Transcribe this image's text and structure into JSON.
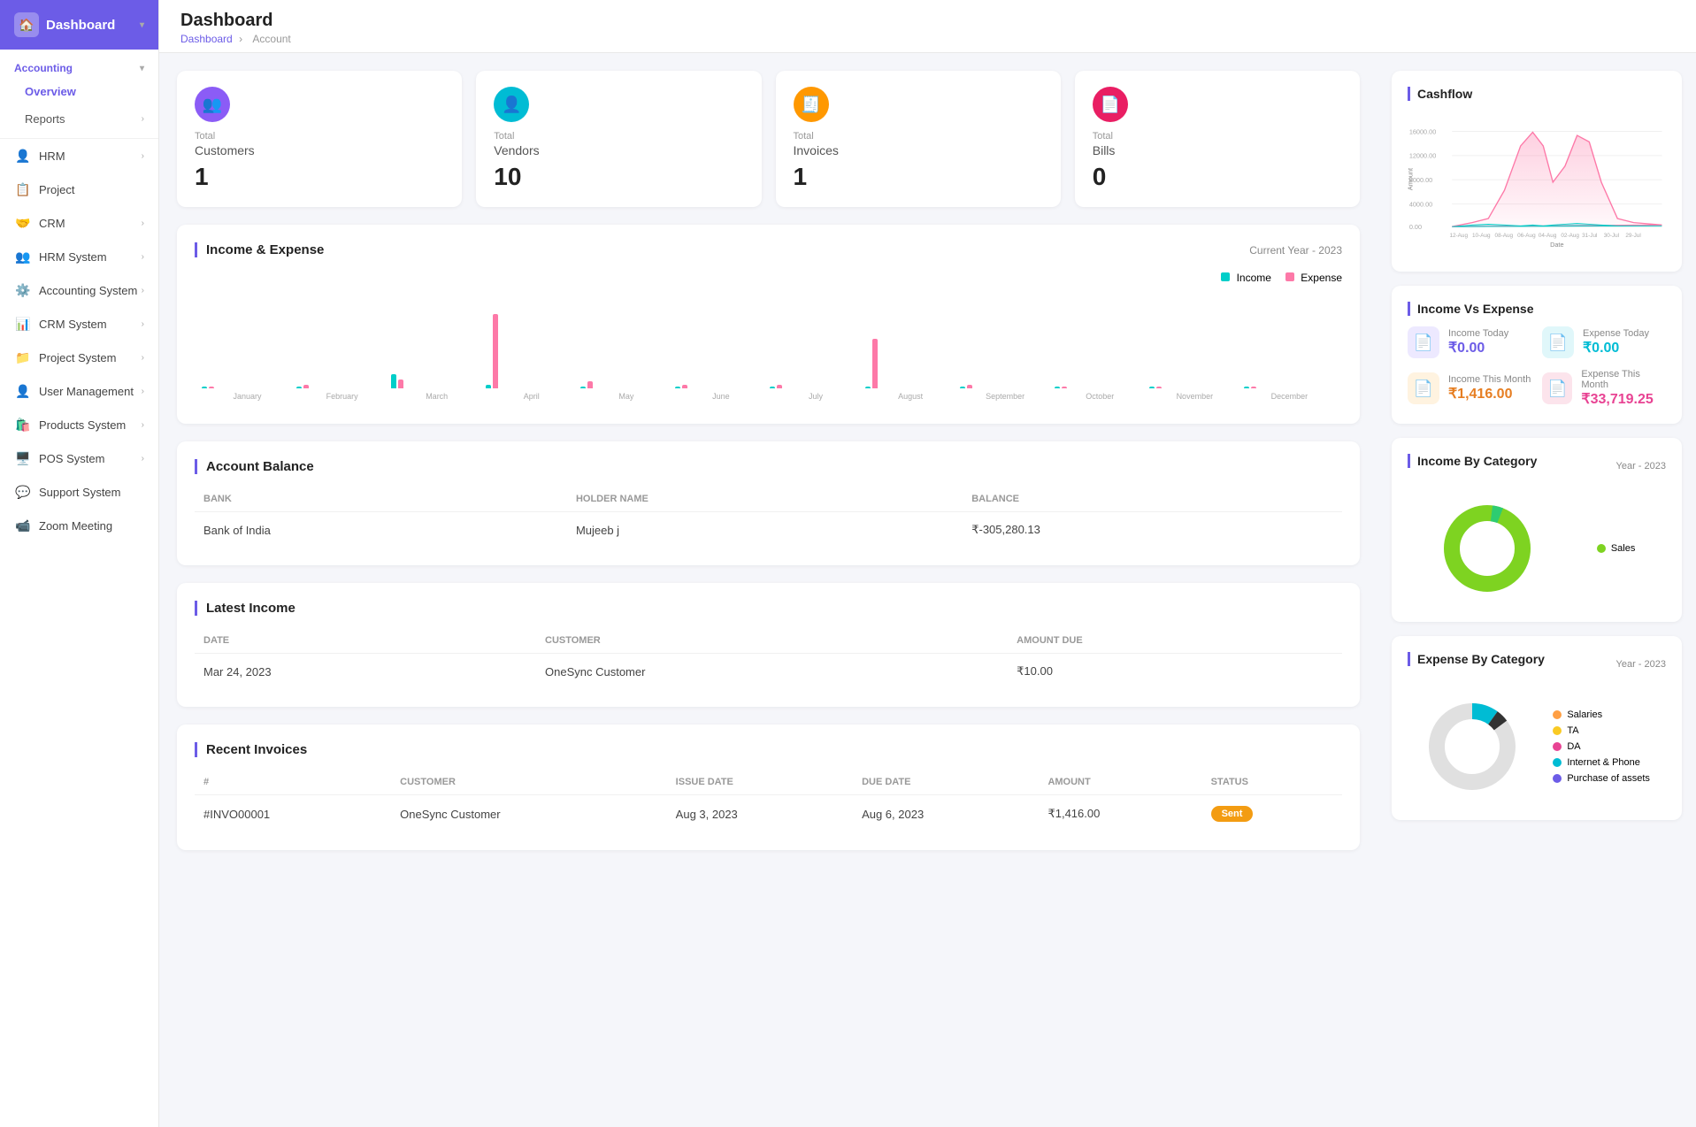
{
  "sidebar": {
    "app_name": "Dashboard",
    "home_icon": "🏠",
    "groups": [
      {
        "label": "Accounting",
        "expanded": true,
        "items": [
          {
            "label": "Overview",
            "active": true,
            "sub": false
          },
          {
            "label": "Reports",
            "sub": true,
            "hasArrow": true
          }
        ]
      }
    ],
    "nav_items": [
      {
        "label": "HRM",
        "icon": "👤",
        "hasArrow": true
      },
      {
        "label": "Project",
        "icon": "📋",
        "hasArrow": false
      },
      {
        "label": "CRM",
        "icon": "🤝",
        "hasArrow": true
      },
      {
        "label": "HRM System",
        "icon": "👥",
        "hasArrow": true
      },
      {
        "label": "Accounting System",
        "icon": "⚙️",
        "hasArrow": true
      },
      {
        "label": "CRM System",
        "icon": "📊",
        "hasArrow": true
      },
      {
        "label": "Project System",
        "icon": "📁",
        "hasArrow": true
      },
      {
        "label": "User Management",
        "icon": "👤",
        "hasArrow": true
      },
      {
        "label": "Products System",
        "icon": "🛍️",
        "hasArrow": true
      },
      {
        "label": "POS System",
        "icon": "🖥️",
        "hasArrow": true
      },
      {
        "label": "Support System",
        "icon": "💬",
        "hasArrow": false
      },
      {
        "label": "Zoom Meeting",
        "icon": "📹",
        "hasArrow": false
      }
    ]
  },
  "page": {
    "title": "Dashboard",
    "breadcrumb": [
      "Dashboard",
      "Account"
    ]
  },
  "stat_cards": [
    {
      "id": "customers",
      "icon": "👥",
      "icon_bg": "#8B5CF6",
      "total_label": "Total",
      "name": "Customers",
      "value": "1"
    },
    {
      "id": "vendors",
      "icon": "👤",
      "icon_bg": "#00BCD4",
      "total_label": "Total",
      "name": "Vendors",
      "value": "10"
    },
    {
      "id": "invoices",
      "icon": "🧾",
      "icon_bg": "#FF9800",
      "total_label": "Total",
      "name": "Invoices",
      "value": "1"
    },
    {
      "id": "bills",
      "icon": "📄",
      "icon_bg": "#E91E63",
      "total_label": "Total",
      "name": "Bills",
      "value": "0"
    }
  ],
  "income_expense": {
    "title": "Income & Expense",
    "meta": "Current Year - 2023",
    "legend": {
      "income": "Income",
      "expense": "Expense"
    },
    "months": [
      "January",
      "February",
      "March",
      "April",
      "May",
      "June",
      "July",
      "August",
      "September",
      "October",
      "November",
      "December"
    ],
    "income_data": [
      0,
      0,
      8,
      2,
      0,
      0,
      0,
      0,
      0,
      0,
      0,
      0
    ],
    "expense_data": [
      0,
      2,
      5,
      42,
      4,
      2,
      2,
      28,
      2,
      0,
      0,
      0
    ]
  },
  "account_balance": {
    "title": "Account Balance",
    "columns": [
      "BANK",
      "HOLDER NAME",
      "BALANCE"
    ],
    "rows": [
      {
        "bank": "Bank of India",
        "holder": "Mujeeb j",
        "balance": "₹-305,280.13"
      }
    ]
  },
  "latest_income": {
    "title": "Latest Income",
    "columns": [
      "DATE",
      "CUSTOMER",
      "AMOUNT DUE"
    ],
    "rows": [
      {
        "date": "Mar 24, 2023",
        "customer": "OneSync Customer",
        "amount": "₹10.00"
      }
    ]
  },
  "recent_invoices": {
    "title": "Recent Invoices",
    "columns": [
      "#",
      "CUSTOMER",
      "ISSUE DATE",
      "DUE DATE",
      "AMOUNT",
      "STATUS"
    ],
    "rows": [
      {
        "num": "#INVO00001",
        "customer": "OneSync Customer",
        "issue_date": "Aug 3, 2023",
        "due_date": "Aug 6, 2023",
        "amount": "₹1,416.00",
        "status": "Sent",
        "status_class": "badge-sent"
      }
    ]
  },
  "cashflow": {
    "title": "Cashflow",
    "x_label": "Date",
    "y_labels": [
      "0.00",
      "4000.00",
      "8000.00",
      "12000.00",
      "16000.00"
    ],
    "x_ticks": [
      "12-Aug",
      "10-Aug",
      "08-Aug",
      "06-Aug",
      "04-Aug",
      "02-Aug",
      "31-Jul",
      "30-Jul",
      "29-Jul"
    ]
  },
  "income_vs_expense": {
    "title": "Income Vs Expense",
    "items": [
      {
        "label": "Income Today",
        "value": "₹0.00",
        "icon": "📄",
        "icon_bg": "#6c5ce7",
        "color": "color-purple"
      },
      {
        "label": "Expense Today",
        "value": "₹0.00",
        "icon": "📄",
        "icon_bg": "#00bcd4",
        "color": "color-teal"
      },
      {
        "label": "Income This Month",
        "value": "₹1,416.00",
        "icon": "📄",
        "icon_bg": "#e67e22",
        "color": "color-orange"
      },
      {
        "label": "Expense This Month",
        "value": "₹33,719.25",
        "icon": "📄",
        "icon_bg": "#e84393",
        "color": "color-pink"
      }
    ]
  },
  "income_by_category": {
    "title": "Income By Category",
    "meta": "Year - 2023",
    "legend": [
      {
        "label": "Sales",
        "color": "#7ed321"
      }
    ],
    "donut": {
      "segments": [
        {
          "value": 100,
          "color": "#7ed321"
        }
      ]
    }
  },
  "expense_by_category": {
    "title": "Expense By Category",
    "meta": "Year - 2023",
    "legend": [
      {
        "label": "Salaries",
        "color": "#ff9f43"
      },
      {
        "label": "TA",
        "color": "#f9ca24"
      },
      {
        "label": "DA",
        "color": "#e84393"
      },
      {
        "label": "Internet & Phone",
        "color": "#00bcd4"
      },
      {
        "label": "Purchase of assets",
        "color": "#6c5ce7"
      }
    ],
    "donut": {
      "segments": [
        {
          "value": 5,
          "color": "#333"
        },
        {
          "value": 10,
          "color": "#00bcd4"
        },
        {
          "value": 85,
          "color": "#f9f9f9"
        }
      ]
    }
  }
}
